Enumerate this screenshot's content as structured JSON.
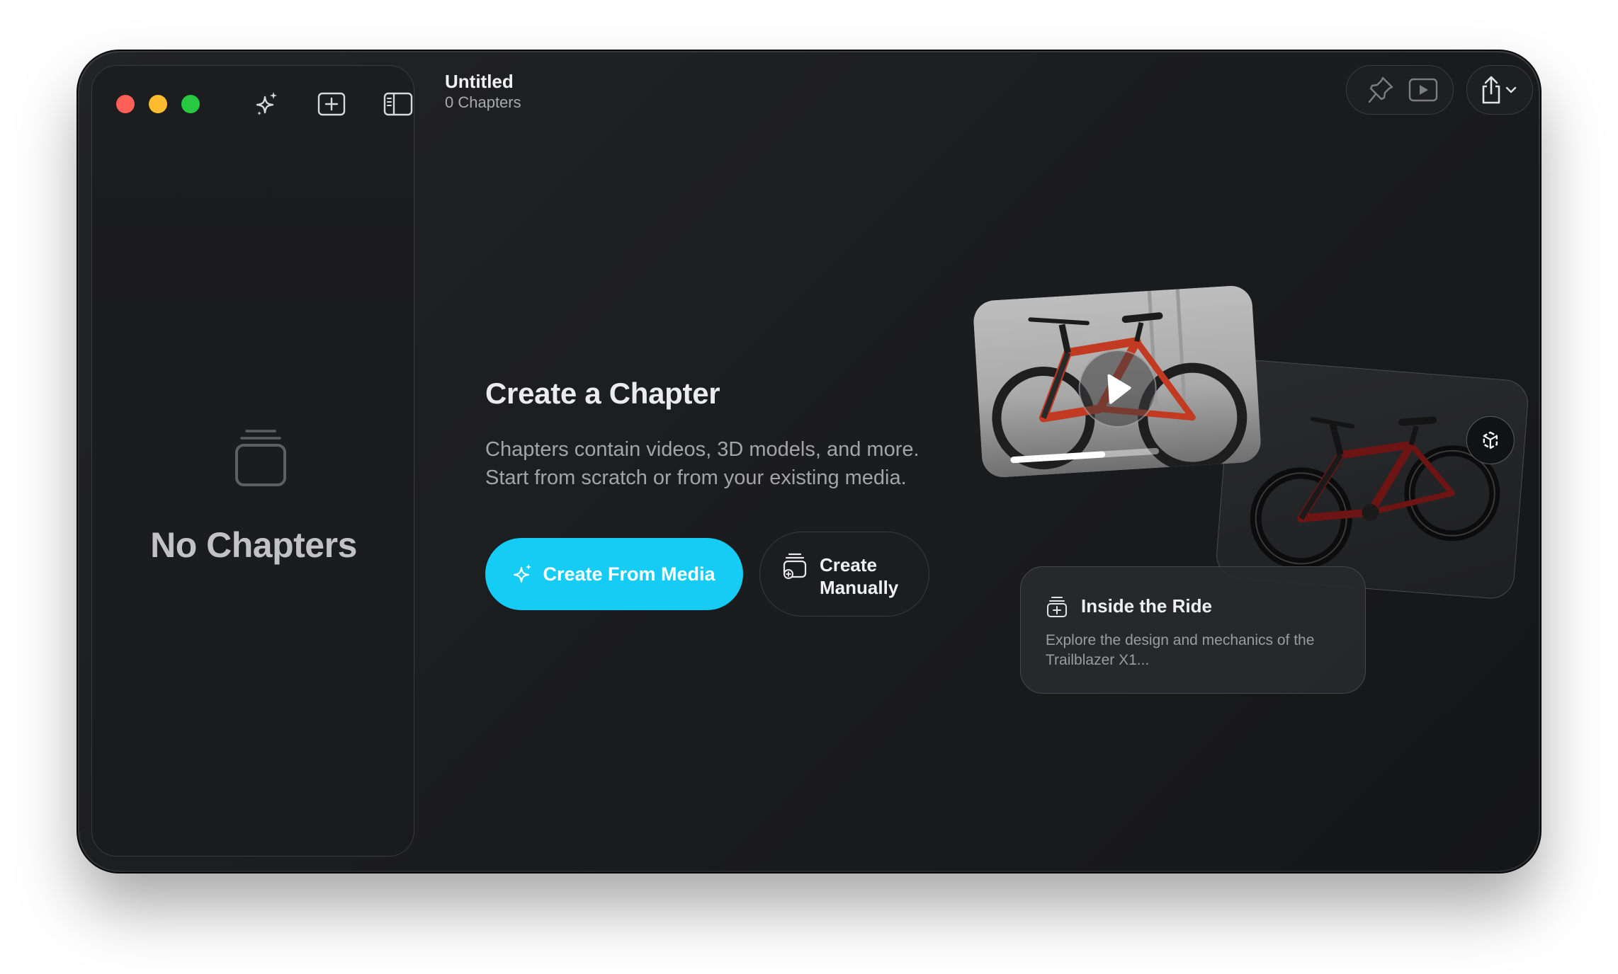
{
  "document": {
    "title": "Untitled",
    "subtitle": "0 Chapters"
  },
  "sidebar": {
    "empty_title": "No Chapters"
  },
  "toolbar": {
    "icons": [
      "sparkles-icon",
      "add-chapter-icon",
      "sidebar-toggle-icon",
      "pin-icon",
      "play-preview-icon",
      "share-icon",
      "chevron-down-icon"
    ]
  },
  "hero": {
    "title": "Create a Chapter",
    "body_line1": "Chapters contain videos, 3D models, and more.",
    "body_line2": "Start from scratch or from your existing media.",
    "primary_button": "Create From Media",
    "secondary_button_line1": "Create",
    "secondary_button_line2": "Manually"
  },
  "preview": {
    "card_title": "Inside the Ride",
    "card_description": "Explore the design and mechanics of the Trailblazer X1..."
  },
  "colors": {
    "accent": "#14ccf4",
    "window_bg": "#1c1d1f",
    "close": "#fe5f57",
    "minimize": "#febc2e",
    "maximize": "#28c840"
  }
}
